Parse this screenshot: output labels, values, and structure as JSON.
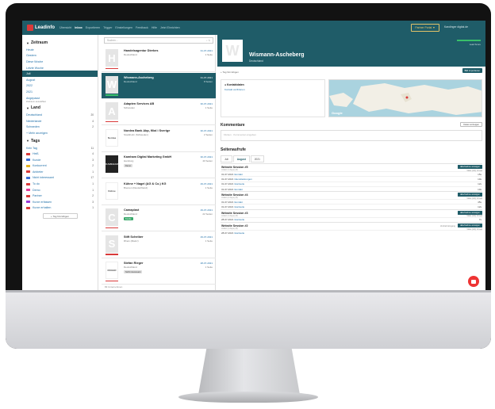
{
  "app": {
    "logo": "Leadinfo"
  },
  "nav": [
    "Übersicht",
    "Inbox",
    "Exportieren",
    "Trigger",
    "Einstellungen",
    "Feedback",
    "Hilfe",
    "Jetzt Einrichten"
  ],
  "header": {
    "fav_button": "Partner Portal ▼",
    "user": "Karolinger digital.de"
  },
  "sidebar": {
    "zeitraum_title": "Zeitraum",
    "zeitraum": [
      {
        "label": "Heute",
        "count": ""
      },
      {
        "label": "Gestern",
        "count": ""
      },
      {
        "label": "Diese Woche",
        "count": ""
      },
      {
        "label": "Letzte Woche",
        "count": ""
      },
      {
        "label": "Juli",
        "count": "",
        "active": true
      },
      {
        "label": "August",
        "count": ""
      },
      {
        "label": "2022",
        "count": ""
      },
      {
        "label": "2021",
        "count": ""
      }
    ],
    "zeitraum_extra": "Angepasst",
    "zeitraum_extra_sub": "Zeitraum auswählen",
    "land_title": "Land",
    "land": [
      {
        "label": "Deutschland",
        "count": "20"
      },
      {
        "label": "Niederlande",
        "count": "4"
      },
      {
        "label": "Schweden",
        "count": "2"
      },
      {
        "label": "+ Mehr anzeigen",
        "count": ""
      }
    ],
    "tags_title": "Tags",
    "tags": [
      {
        "label": "Kein Tag",
        "count": "11",
        "color": ""
      },
      {
        "label": "Heiß",
        "count": "4",
        "color": "#d93a3a"
      },
      {
        "label": "Kunde",
        "count": "3",
        "color": "#3a6fd9"
      },
      {
        "label": "Konkurrent",
        "count": "2",
        "color": "#e6b422"
      },
      {
        "label": "Anbieter",
        "count": "1",
        "color": "#d93a3a"
      },
      {
        "label": "Nicht interessant",
        "count": "17",
        "color": "#3a6fd9"
      },
      {
        "label": "To do",
        "count": "1",
        "color": "#d93a3a"
      },
      {
        "label": "Demo",
        "count": "1",
        "color": "#e63a9a"
      },
      {
        "label": "Partner",
        "count": "2",
        "color": "#d93a3a"
      },
      {
        "label": "Kurze erfassen",
        "count": "3",
        "color": "#9a3ad9"
      },
      {
        "label": "Kurze erhalten",
        "count": "1",
        "color": "#d93a3a"
      }
    ],
    "add_tag": "+ Tag hinzufügen"
  },
  "list": {
    "search_placeholder": "Suchen...",
    "companies": [
      {
        "logo": "H",
        "name": "Handelsagentur Dierkes",
        "loc": "Deutschland",
        "date": "31-07-2021",
        "hits": "1 Seite",
        "badge": "",
        "bar": "red",
        "style": "letter"
      },
      {
        "logo": "W",
        "name": "Wismann-Ascheberg",
        "loc": "Deutschland",
        "date": "31-07-2021",
        "hits": "8 Seiten",
        "badge": "",
        "bar": "green",
        "style": "letter",
        "active": true
      },
      {
        "logo": "A",
        "name": "Adapten Services AB",
        "loc": "Schweden",
        "date": "30-07-2021",
        "hits": "1 Seite",
        "badge": "",
        "bar": "red",
        "style": "letter"
      },
      {
        "logo": "Nordea",
        "name": "Nordea Bank Abp, filial i Sverige",
        "loc": "Stockholm (Schweden)",
        "date": "30-07-2021",
        "hits": "2 Seiten",
        "badge": "",
        "bar": "",
        "style": "plain"
      },
      {
        "logo": "KAMEHAM",
        "name": "Kamham Digital Marketing GmbH",
        "loc": "Hamburg",
        "date": "30-07-2021",
        "hits": "40 Seiten",
        "badge": "Demo",
        "bar": "",
        "style": "dark"
      },
      {
        "logo": "Kühne",
        "name": "Kühne + Nagel (AG & Co.) KG",
        "loc": "Bremen (Deutschland)",
        "date": "29-07-2021",
        "hits": "1 Seite",
        "badge": "",
        "bar": "",
        "style": "plain"
      },
      {
        "logo": "C",
        "name": "Camaplast",
        "loc": "Deutschland",
        "date": "29-07-2021",
        "hits": "22 Seiten",
        "badge": "Kunde",
        "bar": "red",
        "style": "letter"
      },
      {
        "logo": "S",
        "name": "Stift Scheiber",
        "loc": "Rhein (Mainz)",
        "date": "29-07-2021",
        "hits": "1 Seite",
        "badge": "",
        "bar": "red",
        "style": "letter"
      },
      {
        "logo": "ROGER",
        "name": "Stefan Rieger",
        "loc": "Deutschland",
        "date": "28-07-2021",
        "hits": "1 Seite",
        "badge": "Nicht interessant",
        "bar": "red",
        "style": "plain"
      }
    ],
    "footer": "83 Unternehmen"
  },
  "detail": {
    "logo": "W",
    "title": "Wismann-Ascheberg",
    "subtitle": "Deutschland",
    "score": "Lead Score",
    "tags_line": "+ Tag hinzufügen",
    "edit_button": "Bild importieren",
    "contact_title": "Kontaktdaten",
    "contact_link": "Kontakt verifizieren",
    "map_label": "Google",
    "comments_title": "Kommentare",
    "comments_button": "Daten anzeigen",
    "comments_placeholder": "Klicken · Kommentar eingeben",
    "visits_title": "Seitenaufrufe",
    "tabs": [
      "Juli",
      "August",
      "2021"
    ],
    "sessions": [
      {
        "title": "Website Session #5",
        "meta": "Juliett (1 days) (8)",
        "button": "Aufnahme anzeigen",
        "count": "Visits (1/4): 13 sek",
        "extra": "",
        "rows": [
          [
            "31-07-2021",
            "/kontakt",
            "15s"
          ],
          [
            "31-07-2021",
            "/dienstleistungen",
            "10s"
          ],
          [
            "31-07-2021",
            "/startseite",
            "12s"
          ],
          [
            "31-07-2021",
            "/kontakt",
            "10s"
          ]
        ]
      },
      {
        "title": "Website Session #4",
        "meta": "Juliett (2 days) (8)",
        "button": "Aufnahme anzeigen",
        "count": "Visits (1/4): 13 sek",
        "extra": "",
        "rows": [
          [
            "31-07-2021",
            "/kontakt",
            "45s"
          ],
          [
            "31-07-2021",
            "/startseite",
            "12s"
          ]
        ]
      },
      {
        "title": "Website Session #3",
        "meta": "Juliett (1 days) (8)",
        "button": "Aufnahme anzeigen",
        "count": "Visits (1/4): 13 sek",
        "extra": "",
        "rows": [
          [
            "28-07-2021",
            "/startseite",
            "7s"
          ]
        ]
      },
      {
        "title": "Website Session #2",
        "meta": "Juliett (1 days) (8)",
        "button": "Aufnahme anzeigen",
        "count": "Visits (1/4): 13 sek",
        "extra": "Vertrieb Eingang",
        "rows": [
          [
            "28-07-2021",
            "/startseite",
            ""
          ]
        ]
      }
    ]
  },
  "colors": {
    "brand": "#1f5c68",
    "accent": "#d93a3a",
    "success": "#39c06a"
  },
  "icons": {
    "search": "search-icon",
    "chat": "chat-icon"
  }
}
